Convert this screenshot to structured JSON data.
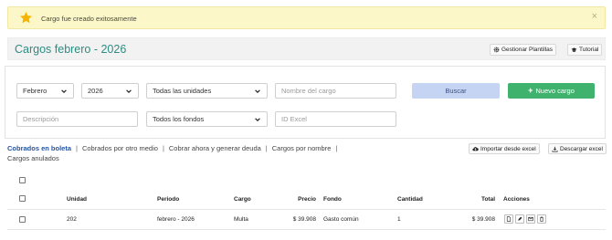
{
  "alert": {
    "message": "Cargo fue creado exitosamente",
    "close": "×",
    "icon": "star-icon"
  },
  "header": {
    "title": "Cargos febrero - 2026",
    "gestionar_label": "Gestionar Plantillas",
    "tutorial_label": "Tutorial"
  },
  "filters": {
    "month": "Febrero",
    "year": "2026",
    "units": "Todas las unidades",
    "cargo_placeholder": "Nombre del cargo",
    "descripcion_placeholder": "Descripción",
    "funds": "Todos los fondos",
    "excel_placeholder": "ID Excel",
    "search_label": "Buscar",
    "new_label": "Nuevo cargo"
  },
  "tabs": [
    {
      "label": "Cobrados en boleta"
    },
    {
      "label": "Cobrados por otro medio"
    },
    {
      "label": "Cobrar ahora y generar deuda"
    },
    {
      "label": "Cargos por nombre"
    },
    {
      "label": "Cargos anulados"
    }
  ],
  "actions": {
    "import_label": "Importar desde excel",
    "download_label": "Descargar excel"
  },
  "table": {
    "columns": [
      "Unidad",
      "Periodo",
      "Cargo",
      "Precio",
      "Fondo",
      "Cantidad",
      "Total",
      "Acciones"
    ],
    "rows": [
      {
        "unidad": "202",
        "periodo": "febrero - 2026",
        "cargo": "Multa",
        "precio": "$ 39.908",
        "fondo": "Gasto común",
        "cantidad": "1",
        "total": "$ 39.908"
      }
    ]
  },
  "colors": {
    "accent_teal": "#2e8c80",
    "alert_bg": "#fbf7c9",
    "search_bg": "#c5d4f2",
    "new_bg": "#3fb36e",
    "tab_active": "#26549e"
  }
}
